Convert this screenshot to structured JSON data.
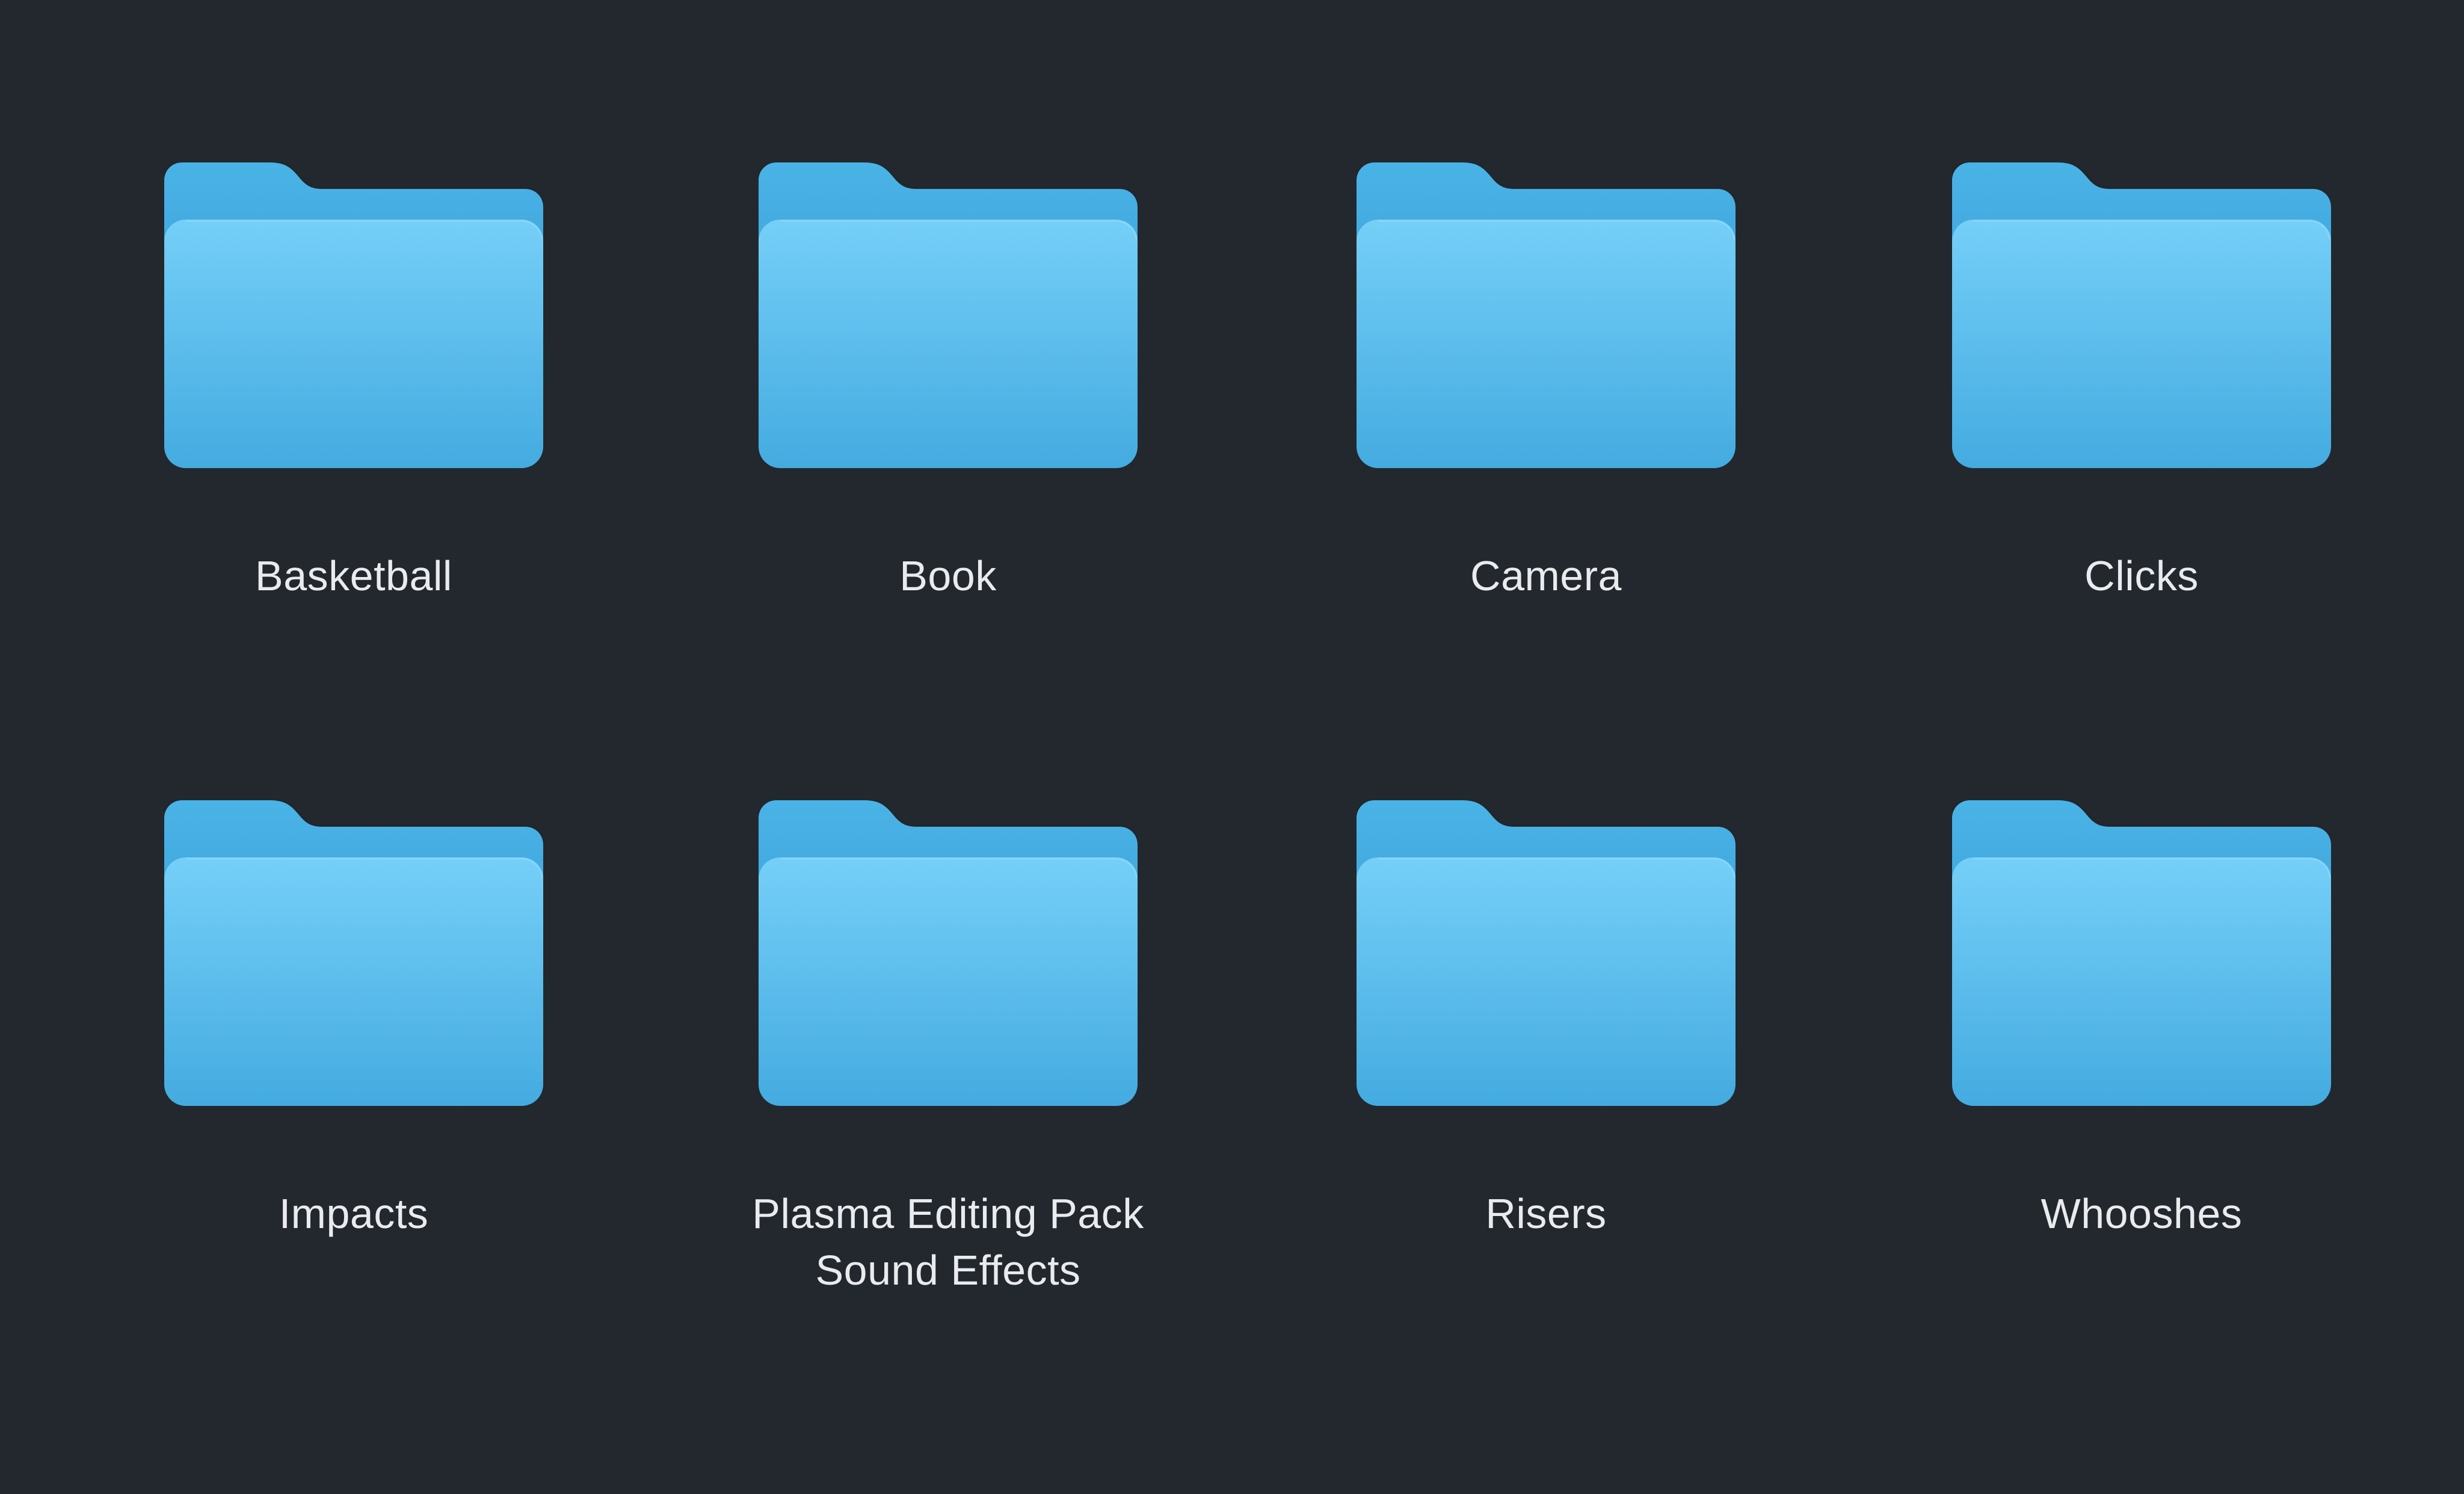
{
  "folders": [
    {
      "name": "Basketball",
      "icon": "folder-icon"
    },
    {
      "name": "Book",
      "icon": "folder-icon"
    },
    {
      "name": "Camera",
      "icon": "folder-icon"
    },
    {
      "name": "Clicks",
      "icon": "folder-icon"
    },
    {
      "name": "Impacts",
      "icon": "folder-icon"
    },
    {
      "name": "Plasma Editing Pack\nSound Effects",
      "icon": "folder-icon"
    },
    {
      "name": "Risers",
      "icon": "folder-icon"
    },
    {
      "name": "Whooshes",
      "icon": "folder-icon"
    }
  ],
  "colors": {
    "background": "#23282e",
    "folder_front_top": "#74cdf7",
    "folder_front_bottom": "#46aee2",
    "folder_back": "#3ea7dd",
    "label_text": "#e9ebed"
  }
}
